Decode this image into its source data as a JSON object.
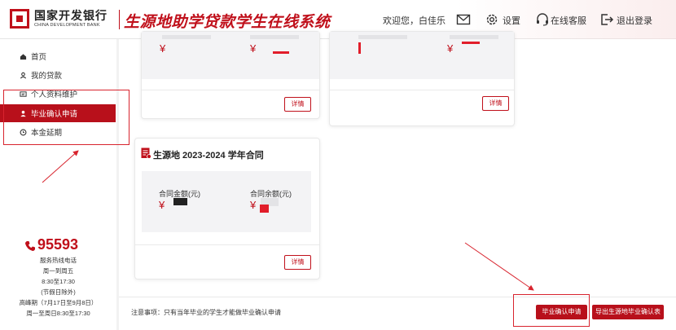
{
  "header": {
    "bank_name_cn": "国家开发银行",
    "bank_name_en": "CHINA DEVELOPMENT BANK",
    "system_title": "生源地助学贷款学生在线系统",
    "welcome": "欢迎您，白佳乐",
    "settings_label": "设置",
    "support_label": "在线客服",
    "logout_label": "退出登录",
    "icons": [
      "mail-icon",
      "gear-icon",
      "headset-icon",
      "logout-icon"
    ]
  },
  "sidebar": {
    "items": [
      {
        "label": "首页",
        "icon": "home-icon",
        "active": false
      },
      {
        "label": "我的贷款",
        "icon": "loan-icon",
        "active": false
      },
      {
        "label": "个人资料维护",
        "icon": "profile-icon",
        "active": false
      },
      {
        "label": "毕业确认申请",
        "icon": "user-icon",
        "active": true
      },
      {
        "label": "本金延期",
        "icon": "clock-icon",
        "active": false
      }
    ],
    "hotline_number": "95593",
    "hotline_label": "服务热线电话",
    "hours_days": "周一到周五",
    "hours_time": "8:30至17:30",
    "hours_note": "(节假日除外)",
    "peak_period": "高峰期（7月17日至9月8日）",
    "peak_hours": "周一至周日8:30至17:30"
  },
  "cards": [
    {
      "title": "",
      "field1_label": "",
      "field2_label": "",
      "currency": "¥",
      "detail_label": "详情"
    },
    {
      "title": "",
      "field1_label": "",
      "field2_label": "",
      "currency": "¥",
      "detail_label": "详情"
    },
    {
      "title": "生源地 2023-2024 学年合同",
      "field1_label": "合同金额(元)",
      "field2_label": "合同余额(元)",
      "currency": "¥",
      "detail_label": "详情"
    }
  ],
  "footer": {
    "notice": "注意事项：只有当年毕业的学生才能做毕业确认申请",
    "apply_button": "毕业确认申请",
    "export_button": "导出生源地毕业确认表"
  },
  "colors": {
    "brand_red": "#c0101b",
    "annotation_red": "#d8242e"
  }
}
